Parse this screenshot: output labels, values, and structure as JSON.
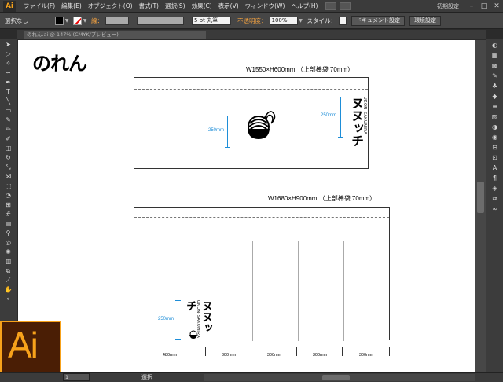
{
  "app": {
    "logo": "Ai"
  },
  "menu": [
    "ファイル(F)",
    "編集(E)",
    "オブジェクト(O)",
    "書式(T)",
    "選択(S)",
    "効果(C)",
    "表示(V)",
    "ウィンドウ(W)",
    "ヘルプ(H)"
  ],
  "workspace": "初期設定",
  "window_controls": {
    "minimize": "–",
    "maximize": "□",
    "close": "✕"
  },
  "control": {
    "selection": "選択なし",
    "stroke_label": "線：",
    "brush": "5 pt 丸筆",
    "opacity_label": "不透明度：",
    "opacity_value": "100%",
    "style_label": "スタイル：",
    "doc_setup": "ドキュメント設定",
    "prefs": "環境設定"
  },
  "doc_tab": "のれん.ai @ 147% (CMYK/プレビュー)",
  "canvas": {
    "title": "のれん",
    "board1": {
      "size_label": "W1550×H600mm （上部棒袋 70mm）",
      "measure1": "250mm",
      "measure2": "250mm",
      "logo_text": "ヌヌッチ",
      "logo_sub": "UKON-SAKUNIRA"
    },
    "board2": {
      "size_label": "W1680×H900mm （上部棒袋 70mm）",
      "measure": "250mm",
      "logo_text": "ヌヌッチ",
      "logo_sub": "UKON-SAKUNIRA",
      "dims": [
        "480mm",
        "300mm",
        "300mm",
        "300mm",
        "300mm"
      ]
    }
  },
  "status": {
    "zoom": "147%",
    "page": "1",
    "tool": "選択"
  },
  "colors": {
    "accent": "#f7a21b",
    "measure": "#1e8ed8"
  }
}
